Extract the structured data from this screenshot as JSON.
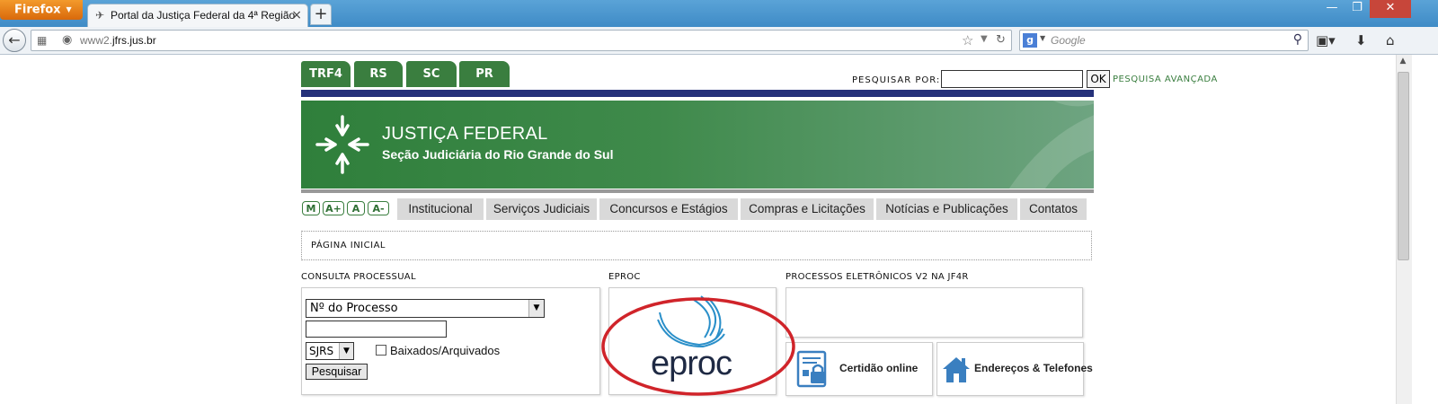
{
  "browser": {
    "menu_button": "Firefox",
    "tab_title": "Portal da Justiça Federal da 4ª Região",
    "url_prefix": "www2.",
    "url_domain": "jfrs.jus.br",
    "search_placeholder": "Google",
    "new_tab": "+",
    "close_tab": "×"
  },
  "site": {
    "region_tabs": [
      "TRF4",
      "RS",
      "SC",
      "PR"
    ],
    "search_label": "PESQUISAR POR:",
    "search_value": "",
    "ok_label": "OK",
    "advanced_link": "PESQUISA AVANÇADA",
    "banner_title": "JUSTIÇA FEDERAL",
    "banner_subtitle": "Seção Judiciária do Rio Grande do Sul",
    "font_buttons": [
      "M",
      "A+",
      "A",
      "A-"
    ],
    "menu": [
      "Institucional",
      "Serviços Judiciais",
      "Concursos e Estágios",
      "Compras e Licitações",
      "Notícias e Publicações",
      "Contatos"
    ],
    "breadcrumb": "PÁGINA INICIAL",
    "sections": {
      "consulta": "CONSULTA PROCESSUAL",
      "eproc": "EPROC",
      "processos": "PROCESSOS ELETRÔNICOS V2 NA JF4R"
    },
    "consulta_form": {
      "type_selected": "Nº do Processo",
      "number_value": "",
      "section_selected": "SJRS",
      "checkbox_label": "Baixados/Arquivados",
      "checkbox_checked": false,
      "submit_label": "Pesquisar"
    },
    "eproc_logo_text": "eproc",
    "quick_links": [
      "Certidão online",
      "Endereços & Telefones"
    ]
  },
  "colors": {
    "brand_green": "#3a7e3f",
    "navy_line": "#25317a",
    "highlight_ellipse": "#d0242a"
  }
}
